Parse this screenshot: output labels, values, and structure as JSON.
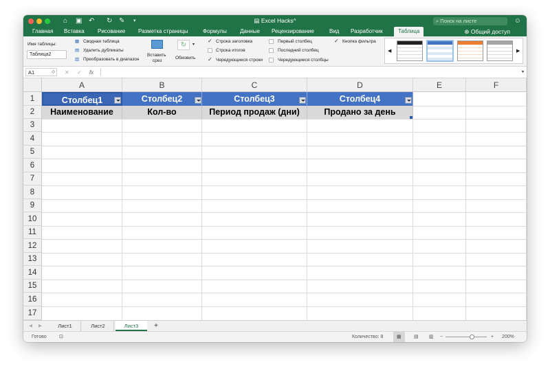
{
  "titlebar": {
    "doc_title": "Excel Hacks^",
    "search_placeholder": "Поиск на листе",
    "colors": {
      "titlebar": "#207346",
      "close": "#fe5f57",
      "minimize": "#febc2e",
      "zoom": "#28c840"
    }
  },
  "tabs": [
    {
      "label": "Главная"
    },
    {
      "label": "Вставка"
    },
    {
      "label": "Рисование"
    },
    {
      "label": "Разметка страницы"
    },
    {
      "label": "Формулы"
    },
    {
      "label": "Данные"
    },
    {
      "label": "Рецензирование"
    },
    {
      "label": "Вид"
    },
    {
      "label": "Разработчик"
    },
    {
      "label": "Таблица",
      "active": true
    }
  ],
  "share_label": "Общий доступ",
  "ribbon": {
    "table_name_label": "Имя таблицы:",
    "table_name_value": "Таблица2",
    "pivot_label": "Сводная таблица",
    "remove_dupes_label": "Удалить дубликаты",
    "convert_label": "Преобразовать в диапазон",
    "insert_slicer_label_1": "Вставить",
    "insert_slicer_label_2": "срез",
    "refresh_label": "Обновить",
    "options": [
      {
        "label": "Строка заголовка",
        "checked": true
      },
      {
        "label": "Строка итогов",
        "checked": false
      },
      {
        "label": "Чередующиеся строки",
        "checked": true
      },
      {
        "label": "Первый столбец",
        "checked": false
      },
      {
        "label": "Последний столбец",
        "checked": false
      },
      {
        "label": "Чередующиеся столбцы",
        "checked": false
      },
      {
        "label": "Кнопка фильтра",
        "checked": true
      }
    ],
    "styles": [
      "black",
      "blue",
      "orange",
      "gray"
    ]
  },
  "formula_bar": {
    "name_box": "A1",
    "fx": "fx",
    "value": ""
  },
  "columns": [
    "A",
    "B",
    "C",
    "D",
    "E",
    "F"
  ],
  "rows": [
    "1",
    "2",
    "3",
    "4",
    "5",
    "6",
    "7",
    "8",
    "9",
    "10",
    "11",
    "12",
    "13",
    "14",
    "15",
    "16",
    "17"
  ],
  "table": {
    "headers": [
      "Столбец1",
      "Столбец2",
      "Столбец3",
      "Столбец4"
    ],
    "row2": [
      "Наименование",
      "Кол-во",
      "Период продаж (дни)",
      "Продано за день"
    ],
    "colors": {
      "header": "#4472c4",
      "band": "#d9d9d9"
    }
  },
  "sheets": [
    {
      "label": "Лист1"
    },
    {
      "label": "Лист2"
    },
    {
      "label": "Лист3",
      "active": true
    }
  ],
  "add_sheet_label": "+",
  "status": {
    "ready": "Готово",
    "count_label": "Количество: 8",
    "zoom": "200%",
    "zoom_minus": "−",
    "zoom_plus": "+"
  }
}
